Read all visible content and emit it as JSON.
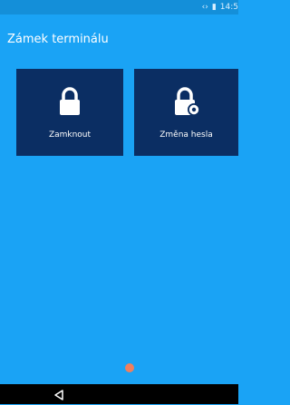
{
  "status_bar": {
    "time": "14:5",
    "icons": [
      "code-arrows-icon",
      "signal-icon"
    ]
  },
  "page": {
    "title": "Zámek terminálu"
  },
  "tiles": [
    {
      "label": "Zamknout",
      "icon": "lock-icon"
    },
    {
      "label": "Změna hesla",
      "icon": "lock-gear-icon"
    }
  ],
  "pager": {
    "current": 1,
    "total": 1
  },
  "nav": {
    "icons": [
      "back-icon"
    ]
  },
  "colors": {
    "background": "#1aa3f5",
    "tile": "#0b2e63",
    "page_dot": "#f07f5e",
    "nav_bar": "#000000"
  }
}
